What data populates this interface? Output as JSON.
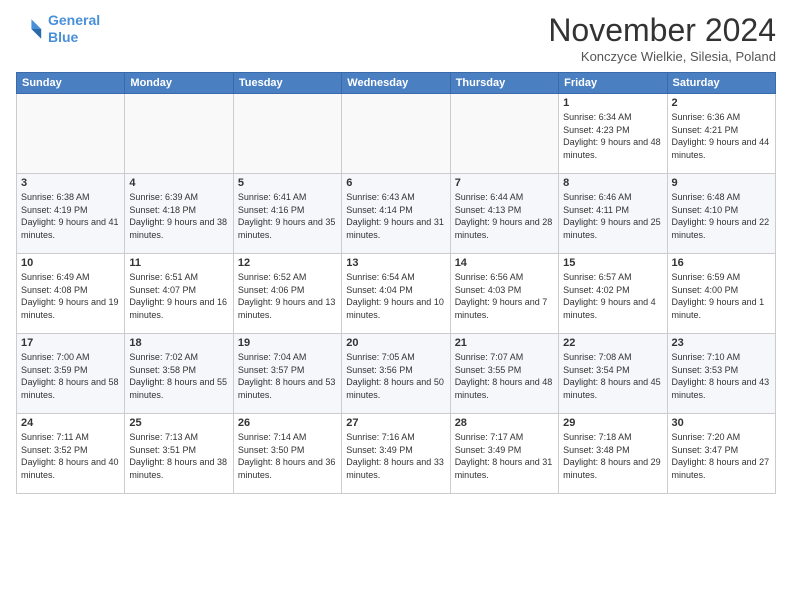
{
  "logo": {
    "line1": "General",
    "line2": "Blue"
  },
  "title": "November 2024",
  "location": "Konczyce Wielkie, Silesia, Poland",
  "days_of_week": [
    "Sunday",
    "Monday",
    "Tuesday",
    "Wednesday",
    "Thursday",
    "Friday",
    "Saturday"
  ],
  "weeks": [
    [
      {
        "num": "",
        "info": ""
      },
      {
        "num": "",
        "info": ""
      },
      {
        "num": "",
        "info": ""
      },
      {
        "num": "",
        "info": ""
      },
      {
        "num": "",
        "info": ""
      },
      {
        "num": "1",
        "info": "Sunrise: 6:34 AM\nSunset: 4:23 PM\nDaylight: 9 hours and 48 minutes."
      },
      {
        "num": "2",
        "info": "Sunrise: 6:36 AM\nSunset: 4:21 PM\nDaylight: 9 hours and 44 minutes."
      }
    ],
    [
      {
        "num": "3",
        "info": "Sunrise: 6:38 AM\nSunset: 4:19 PM\nDaylight: 9 hours and 41 minutes."
      },
      {
        "num": "4",
        "info": "Sunrise: 6:39 AM\nSunset: 4:18 PM\nDaylight: 9 hours and 38 minutes."
      },
      {
        "num": "5",
        "info": "Sunrise: 6:41 AM\nSunset: 4:16 PM\nDaylight: 9 hours and 35 minutes."
      },
      {
        "num": "6",
        "info": "Sunrise: 6:43 AM\nSunset: 4:14 PM\nDaylight: 9 hours and 31 minutes."
      },
      {
        "num": "7",
        "info": "Sunrise: 6:44 AM\nSunset: 4:13 PM\nDaylight: 9 hours and 28 minutes."
      },
      {
        "num": "8",
        "info": "Sunrise: 6:46 AM\nSunset: 4:11 PM\nDaylight: 9 hours and 25 minutes."
      },
      {
        "num": "9",
        "info": "Sunrise: 6:48 AM\nSunset: 4:10 PM\nDaylight: 9 hours and 22 minutes."
      }
    ],
    [
      {
        "num": "10",
        "info": "Sunrise: 6:49 AM\nSunset: 4:08 PM\nDaylight: 9 hours and 19 minutes."
      },
      {
        "num": "11",
        "info": "Sunrise: 6:51 AM\nSunset: 4:07 PM\nDaylight: 9 hours and 16 minutes."
      },
      {
        "num": "12",
        "info": "Sunrise: 6:52 AM\nSunset: 4:06 PM\nDaylight: 9 hours and 13 minutes."
      },
      {
        "num": "13",
        "info": "Sunrise: 6:54 AM\nSunset: 4:04 PM\nDaylight: 9 hours and 10 minutes."
      },
      {
        "num": "14",
        "info": "Sunrise: 6:56 AM\nSunset: 4:03 PM\nDaylight: 9 hours and 7 minutes."
      },
      {
        "num": "15",
        "info": "Sunrise: 6:57 AM\nSunset: 4:02 PM\nDaylight: 9 hours and 4 minutes."
      },
      {
        "num": "16",
        "info": "Sunrise: 6:59 AM\nSunset: 4:00 PM\nDaylight: 9 hours and 1 minute."
      }
    ],
    [
      {
        "num": "17",
        "info": "Sunrise: 7:00 AM\nSunset: 3:59 PM\nDaylight: 8 hours and 58 minutes."
      },
      {
        "num": "18",
        "info": "Sunrise: 7:02 AM\nSunset: 3:58 PM\nDaylight: 8 hours and 55 minutes."
      },
      {
        "num": "19",
        "info": "Sunrise: 7:04 AM\nSunset: 3:57 PM\nDaylight: 8 hours and 53 minutes."
      },
      {
        "num": "20",
        "info": "Sunrise: 7:05 AM\nSunset: 3:56 PM\nDaylight: 8 hours and 50 minutes."
      },
      {
        "num": "21",
        "info": "Sunrise: 7:07 AM\nSunset: 3:55 PM\nDaylight: 8 hours and 48 minutes."
      },
      {
        "num": "22",
        "info": "Sunrise: 7:08 AM\nSunset: 3:54 PM\nDaylight: 8 hours and 45 minutes."
      },
      {
        "num": "23",
        "info": "Sunrise: 7:10 AM\nSunset: 3:53 PM\nDaylight: 8 hours and 43 minutes."
      }
    ],
    [
      {
        "num": "24",
        "info": "Sunrise: 7:11 AM\nSunset: 3:52 PM\nDaylight: 8 hours and 40 minutes."
      },
      {
        "num": "25",
        "info": "Sunrise: 7:13 AM\nSunset: 3:51 PM\nDaylight: 8 hours and 38 minutes."
      },
      {
        "num": "26",
        "info": "Sunrise: 7:14 AM\nSunset: 3:50 PM\nDaylight: 8 hours and 36 minutes."
      },
      {
        "num": "27",
        "info": "Sunrise: 7:16 AM\nSunset: 3:49 PM\nDaylight: 8 hours and 33 minutes."
      },
      {
        "num": "28",
        "info": "Sunrise: 7:17 AM\nSunset: 3:49 PM\nDaylight: 8 hours and 31 minutes."
      },
      {
        "num": "29",
        "info": "Sunrise: 7:18 AM\nSunset: 3:48 PM\nDaylight: 8 hours and 29 minutes."
      },
      {
        "num": "30",
        "info": "Sunrise: 7:20 AM\nSunset: 3:47 PM\nDaylight: 8 hours and 27 minutes."
      }
    ]
  ]
}
